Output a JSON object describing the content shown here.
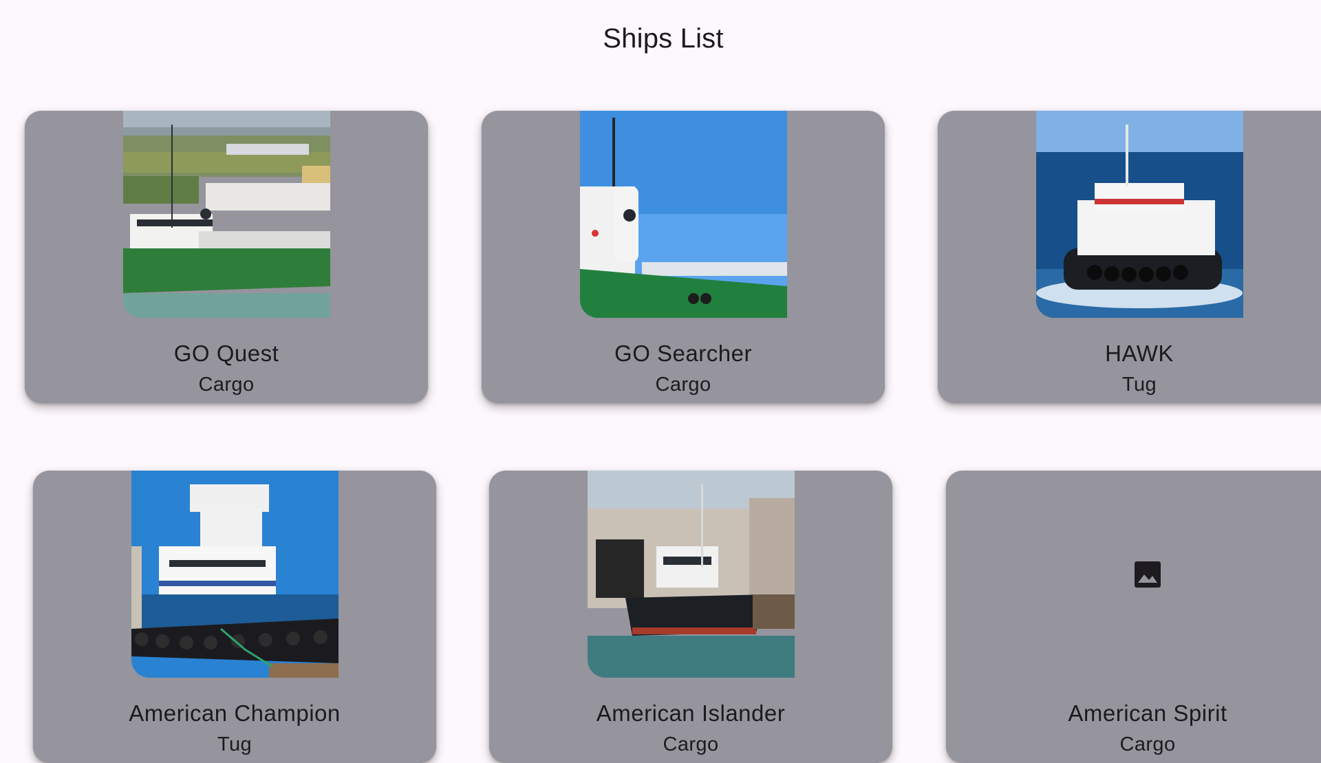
{
  "page": {
    "title": "Ships List"
  },
  "colors": {
    "background": "#fdf8fd",
    "card": "#96949d",
    "text": "#1b1b1f"
  },
  "ships": [
    {
      "name": "GO Quest",
      "type": "Cargo",
      "image": "ship-photo"
    },
    {
      "name": "GO Searcher",
      "type": "Cargo",
      "image": "ship-photo"
    },
    {
      "name": "HAWK",
      "type": "Tug",
      "image": "ship-photo"
    },
    {
      "name": "American Champion",
      "type": "Tug",
      "image": "ship-photo"
    },
    {
      "name": "American Islander",
      "type": "Cargo",
      "image": "ship-photo"
    },
    {
      "name": "American Spirit",
      "type": "Cargo",
      "image": "image-placeholder-icon"
    }
  ]
}
